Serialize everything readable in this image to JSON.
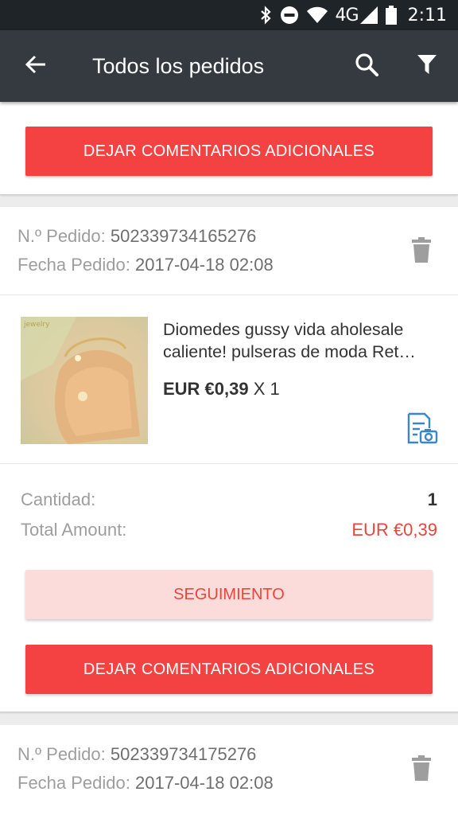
{
  "status_bar": {
    "network_label": "4G",
    "time": "2:11"
  },
  "toolbar": {
    "title": "Todos los pedidos",
    "icons": [
      "back-arrow-icon",
      "search-icon",
      "filter-icon"
    ]
  },
  "orders": [
    {
      "feedback_label": "DEJAR COMENTARIOS ADICIONALES"
    },
    {
      "order_no_label": "N.º Pedido:",
      "order_no": "502339734165276",
      "date_label": "Fecha Pedido:",
      "date": "2017-04-18 02:08",
      "product": {
        "title_line1": "Diomedes gussy vida aholesale",
        "title_line2": "caliente! pulseras de moda Ret…",
        "price": "EUR €0,39",
        "qty": "X 1"
      },
      "quantity_label": "Cantidad:",
      "quantity": "1",
      "total_label": "Total Amount:",
      "total": "EUR €0,39",
      "tracking_label": "SEGUIMIENTO",
      "feedback_label": "DEJAR COMENTARIOS ADICIONALES"
    },
    {
      "order_no_label": "N.º Pedido:",
      "order_no": "502339734175276",
      "date_label": "Fecha Pedido:",
      "date": "2017-04-18 02:08"
    }
  ],
  "colors": {
    "toolbar": "#343a40",
    "status_bar": "#1f2428",
    "primary_button": "#f44242",
    "secondary_button_bg": "#fcdcda",
    "total_amount": "#e8453c",
    "receipt_icon": "#3a86c8"
  }
}
